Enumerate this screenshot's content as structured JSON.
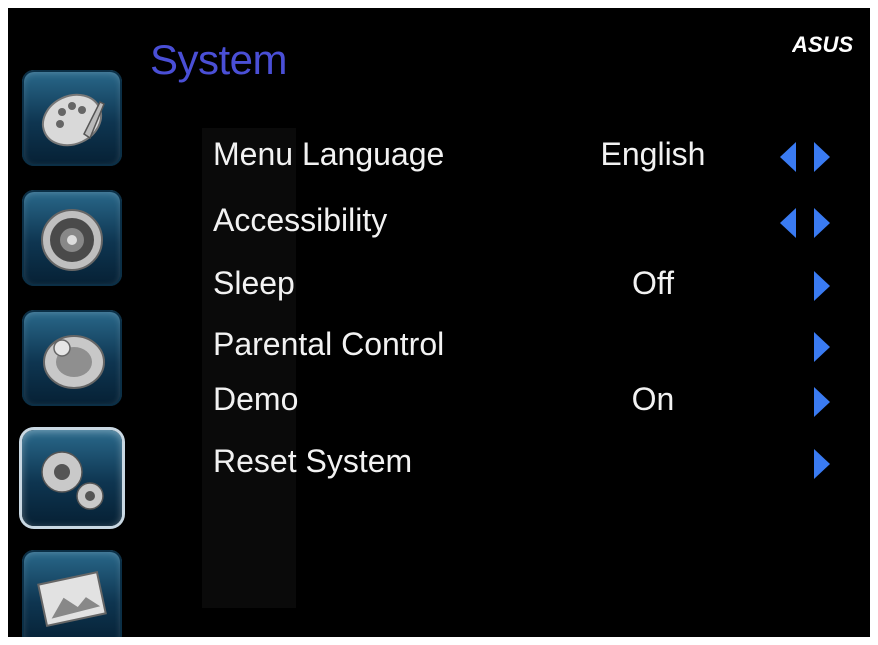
{
  "title": "System",
  "brand": "ASUS",
  "sidebar": {
    "items": [
      {
        "name": "picture",
        "icon": "palette-icon",
        "selected": false
      },
      {
        "name": "sound",
        "icon": "speaker-icon",
        "selected": false
      },
      {
        "name": "tv",
        "icon": "satellite-dish-icon",
        "selected": false
      },
      {
        "name": "system",
        "icon": "gears-icon",
        "selected": true
      },
      {
        "name": "photo",
        "icon": "picture-frame-icon",
        "selected": false
      }
    ]
  },
  "menu": {
    "items": [
      {
        "label": "Menu Language",
        "value": "English",
        "nav": "left-right"
      },
      {
        "label": "Accessibility",
        "value": "",
        "nav": "left-right"
      },
      {
        "label": "Sleep",
        "value": "Off",
        "nav": "right"
      },
      {
        "label": "Parental Control",
        "value": "",
        "nav": "right"
      },
      {
        "label": "Demo",
        "value": "On",
        "nav": "right"
      },
      {
        "label": "Reset System",
        "value": "",
        "nav": "right"
      }
    ]
  },
  "colors": {
    "title": "#4a4fd6",
    "arrow": "#3a7bf2",
    "text": "#f2f2f2",
    "background": "#000000"
  }
}
